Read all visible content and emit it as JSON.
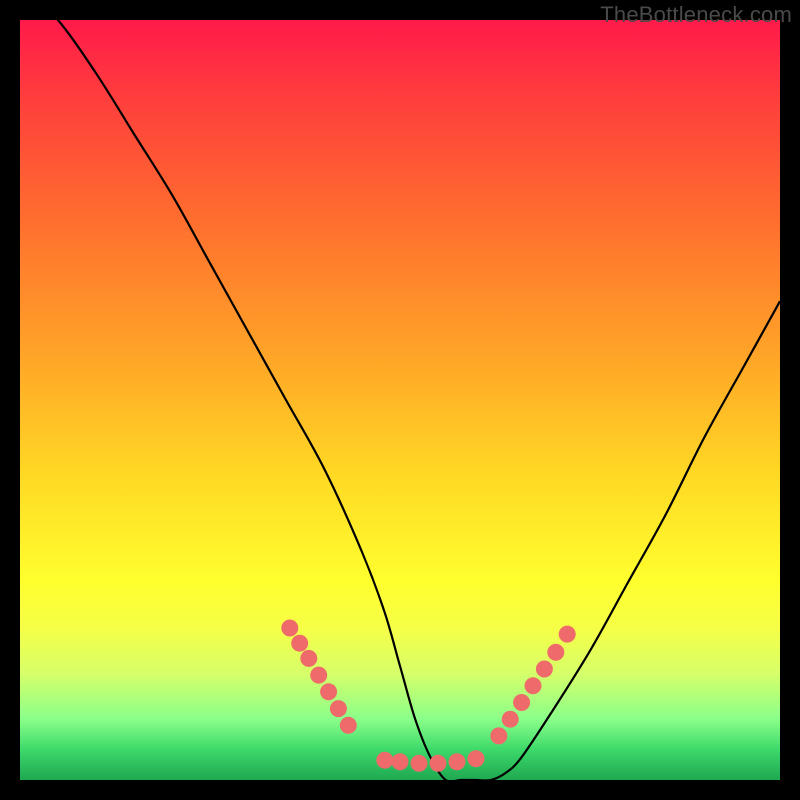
{
  "watermark_text": "TheBottleneck.com",
  "colors": {
    "background": "#000000",
    "curve": "#000000",
    "dot_fill": "#ef6a6a",
    "dot_stroke": "#ef6a6a",
    "gradient_top": "#ff1a4a",
    "gradient_bottom": "#1fa850"
  },
  "chart_data": {
    "type": "line",
    "title": "",
    "xlabel": "",
    "ylabel": "",
    "xlim": [
      0,
      100
    ],
    "ylim": [
      0,
      100
    ],
    "legend": false,
    "grid": false,
    "series": [
      {
        "name": "bottleneck-curve",
        "x": [
          0,
          5,
          10,
          15,
          20,
          25,
          30,
          35,
          40,
          45,
          48,
          50,
          52,
          54,
          56,
          58,
          60,
          62,
          64,
          66,
          70,
          75,
          80,
          85,
          90,
          95,
          100
        ],
        "values": [
          105,
          100,
          93,
          85,
          77,
          68,
          59,
          50,
          41,
          30,
          22,
          15,
          8,
          3,
          0,
          0,
          0,
          0,
          1,
          3,
          9,
          17,
          26,
          35,
          45,
          54,
          63
        ]
      }
    ],
    "dots": [
      {
        "x_pct": 35.5,
        "y_pct": 80.0
      },
      {
        "x_pct": 36.8,
        "y_pct": 82.0
      },
      {
        "x_pct": 38.0,
        "y_pct": 84.0
      },
      {
        "x_pct": 39.3,
        "y_pct": 86.2
      },
      {
        "x_pct": 40.6,
        "y_pct": 88.4
      },
      {
        "x_pct": 41.9,
        "y_pct": 90.6
      },
      {
        "x_pct": 43.2,
        "y_pct": 92.8
      },
      {
        "x_pct": 48.0,
        "y_pct": 97.4
      },
      {
        "x_pct": 50.0,
        "y_pct": 97.6
      },
      {
        "x_pct": 52.5,
        "y_pct": 97.8
      },
      {
        "x_pct": 55.0,
        "y_pct": 97.8
      },
      {
        "x_pct": 57.5,
        "y_pct": 97.6
      },
      {
        "x_pct": 60.0,
        "y_pct": 97.2
      },
      {
        "x_pct": 63.0,
        "y_pct": 94.2
      },
      {
        "x_pct": 64.5,
        "y_pct": 92.0
      },
      {
        "x_pct": 66.0,
        "y_pct": 89.8
      },
      {
        "x_pct": 67.5,
        "y_pct": 87.6
      },
      {
        "x_pct": 69.0,
        "y_pct": 85.4
      },
      {
        "x_pct": 70.5,
        "y_pct": 83.2
      },
      {
        "x_pct": 72.0,
        "y_pct": 80.8
      }
    ]
  }
}
